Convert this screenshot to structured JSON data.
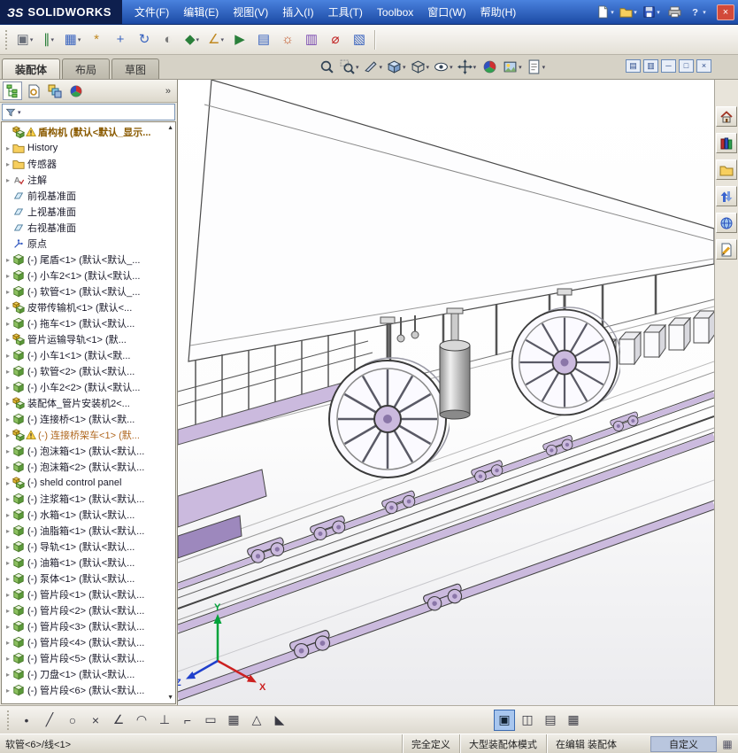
{
  "colors": {
    "accent-lavender": "#cbbade",
    "accent-lavender-dark": "#9d88bd",
    "outline": "#4a4a4a",
    "triad-x": "#cc2020",
    "triad-y": "#00a33a",
    "triad-z": "#2040cc",
    "titlebar-top": "#4a82de",
    "titlebar-bottom": "#1c4aa4",
    "selection-edit": "#b06820"
  },
  "titlebar": {
    "logo_mark": "ЗS",
    "logo_text": "SOLIDWORKS",
    "close_glyph": "×",
    "menus": [
      {
        "name": "menu-file",
        "label": "文件(F)"
      },
      {
        "name": "menu-edit",
        "label": "编辑(E)"
      },
      {
        "name": "menu-view",
        "label": "视图(V)"
      },
      {
        "name": "menu-insert",
        "label": "插入(I)"
      },
      {
        "name": "menu-tools",
        "label": "工具(T)"
      },
      {
        "name": "menu-toolbox",
        "label": "Toolbox"
      },
      {
        "name": "menu-window",
        "label": "窗口(W)"
      },
      {
        "name": "menu-help",
        "label": "帮助(H)"
      }
    ],
    "quick_icons": [
      {
        "name": "new-document-button",
        "sym": "page",
        "caret": true
      },
      {
        "name": "open-button",
        "sym": "folder",
        "caret": true
      },
      {
        "name": "save-button",
        "sym": "disk",
        "caret": true
      },
      {
        "name": "print-button",
        "sym": "printer"
      },
      {
        "name": "help-button",
        "sym": "help",
        "caret": true
      }
    ]
  },
  "toolbar": {
    "items": [
      {
        "name": "insert-components-button",
        "glyph": "▣",
        "color": "#6a6f7a",
        "caret": true
      },
      {
        "name": "mate-button",
        "glyph": "∥",
        "color": "#2a7f3a",
        "caret": true
      },
      {
        "name": "linear-component-pattern-button",
        "glyph": "▦",
        "color": "#3a64bf",
        "caret": true
      },
      {
        "name": "smart-fasteners-button",
        "glyph": "*",
        "color": "#c08820"
      },
      {
        "name": "move-component-button",
        "glyph": "+",
        "color": "#3a64bf"
      },
      {
        "name": "rotate-component-button",
        "glyph": "↻",
        "color": "#3a64bf"
      },
      {
        "name": "show-hidden-components-button",
        "glyph": "◐",
        "color": "#7a7a7a"
      },
      {
        "name": "assembly-features-button",
        "glyph": "◆",
        "color": "#2a7f3a",
        "caret": true
      },
      {
        "name": "reference-geometry-button",
        "glyph": "∠",
        "color": "#c08820",
        "caret": true
      },
      {
        "name": "new-motion-study-button",
        "glyph": "▶",
        "color": "#2a7f3a"
      },
      {
        "name": "bill-of-materials-button",
        "glyph": "▤",
        "color": "#3a64bf"
      },
      {
        "name": "exploded-view-button",
        "glyph": "☼",
        "color": "#c05020"
      },
      {
        "name": "interference-detection-button",
        "glyph": "▥",
        "color": "#7a4ab0"
      },
      {
        "name": "measure-button",
        "glyph": "⌀",
        "color": "#c02020"
      },
      {
        "name": "section-button",
        "glyph": "▧",
        "color": "#3a64bf"
      }
    ]
  },
  "tabs": [
    {
      "name": "tab-assembly",
      "label": "装配体",
      "active": true
    },
    {
      "name": "tab-layout",
      "label": "布局"
    },
    {
      "name": "tab-sketch",
      "label": "草图"
    }
  ],
  "headsup": {
    "items": [
      {
        "name": "zoom-fit-button",
        "sym": "zoom"
      },
      {
        "name": "zoom-area-button",
        "sym": "zoomwin",
        "caret": true
      },
      {
        "name": "section-view-button",
        "sym": "knife",
        "caret": true
      },
      {
        "name": "view-orientation-button",
        "sym": "cube3d",
        "caret": true
      },
      {
        "name": "display-style-button",
        "sym": "dstyle",
        "caret": true
      },
      {
        "name": "hide-show-items-button",
        "sym": "eye",
        "caret": true
      },
      {
        "name": "rotate-view-button",
        "sym": "move3d",
        "caret": true
      },
      {
        "name": "edit-appearance-button",
        "sym": "ball"
      },
      {
        "name": "apply-scene-button",
        "sym": "ball2",
        "caret": true
      },
      {
        "name": "view-settings-button",
        "sym": "note",
        "caret": true
      }
    ]
  },
  "doc_window_buttons": [
    {
      "name": "doc-cascade-button",
      "glyph": "▤"
    },
    {
      "name": "doc-tile-button",
      "glyph": "▥"
    },
    {
      "name": "doc-minimize-button",
      "glyph": "─"
    },
    {
      "name": "doc-restore-button",
      "glyph": "□"
    },
    {
      "name": "doc-close-button",
      "glyph": "×"
    }
  ],
  "manager_tabs": {
    "items": [
      {
        "name": "featuremanager-tab",
        "sym": "tree",
        "active": true
      },
      {
        "name": "propertymanager-tab",
        "sym": "prop"
      },
      {
        "name": "configurationmanager-tab",
        "sym": "config"
      },
      {
        "name": "displaymanager-tab",
        "sym": "ball"
      }
    ],
    "chevron": "»"
  },
  "tree": {
    "root": "盾构机 (默认<默认_显示...",
    "items": [
      {
        "sym": "folder",
        "label": "History",
        "arrow": true
      },
      {
        "sym": "folder",
        "label": "传感器",
        "arrow": true
      },
      {
        "sym": "annot",
        "label": "注解",
        "arrow": true
      },
      {
        "sym": "plane",
        "label": "前视基准面"
      },
      {
        "sym": "plane",
        "label": "上视基准面"
      },
      {
        "sym": "plane",
        "label": "右视基准面"
      },
      {
        "sym": "origin",
        "label": "原点"
      },
      {
        "sym": "part",
        "label": "(-) 尾盾<1> (默认<默认_...",
        "arrow": true
      },
      {
        "sym": "part",
        "label": "(-) 小车2<1> (默认<默认...",
        "arrow": true
      },
      {
        "sym": "part",
        "label": "(-) 软管<1> (默认<默认_...",
        "arrow": true
      },
      {
        "sym": "asm",
        "label": "皮带传输机<1> (默认<...",
        "arrow": true
      },
      {
        "sym": "part",
        "label": "(-) 拖车<1> (默认<默认...",
        "arrow": true
      },
      {
        "sym": "asm",
        "label": "管片运输导轨<1> (默...",
        "arrow": true
      },
      {
        "sym": "part",
        "label": "(-) 小车1<1> (默认<默...",
        "arrow": true
      },
      {
        "sym": "part",
        "label": "(-) 软管<2> (默认<默认...",
        "arrow": true
      },
      {
        "sym": "part",
        "label": "(-) 小车2<2> (默认<默认...",
        "arrow": true
      },
      {
        "sym": "asm",
        "label": "装配体_管片安装机2<...",
        "arrow": true
      },
      {
        "sym": "part",
        "label": "(-) 连接桥<1> (默认<默...",
        "arrow": true
      },
      {
        "sym": "asm",
        "label": "(-) 连接桥架车<1> (默...",
        "arrow": true,
        "warn": true,
        "selected": true
      },
      {
        "sym": "part",
        "label": "(-) 泡沫箱<1> (默认<默认...",
        "arrow": true
      },
      {
        "sym": "part",
        "label": "(-) 泡沫箱<2> (默认<默认...",
        "arrow": true
      },
      {
        "sym": "asm",
        "label": "(-) sheld control panel ",
        "arrow": true
      },
      {
        "sym": "part",
        "label": "(-) 注浆箱<1> (默认<默认...",
        "arrow": true
      },
      {
        "sym": "part",
        "label": "(-) 水箱<1> (默认<默认...",
        "arrow": true
      },
      {
        "sym": "part",
        "label": "(-) 油脂箱<1> (默认<默认...",
        "arrow": true
      },
      {
        "sym": "part",
        "label": "(-) 导轨<1> (默认<默认...",
        "arrow": true
      },
      {
        "sym": "part",
        "label": "(-) 油箱<1> (默认<默认...",
        "arrow": true
      },
      {
        "sym": "part",
        "label": "(-) 泵体<1> (默认<默认...",
        "arrow": true
      },
      {
        "sym": "part",
        "label": "(-) 管片段<1> (默认<默认...",
        "arrow": true
      },
      {
        "sym": "part",
        "label": "(-) 管片段<2> (默认<默认...",
        "arrow": true
      },
      {
        "sym": "part",
        "label": "(-) 管片段<3> (默认<默认...",
        "arrow": true
      },
      {
        "sym": "part",
        "label": "(-) 管片段<4> (默认<默认...",
        "arrow": true
      },
      {
        "sym": "part",
        "label": "(-) 管片段<5> (默认<默认...",
        "arrow": true
      },
      {
        "sym": "part",
        "label": "(-) 刀盘<1> (默认<默认...",
        "arrow": true
      },
      {
        "sym": "part",
        "label": "(-) 管片段<6> (默认<默认...",
        "arrow": true
      }
    ]
  },
  "task_pane": {
    "items": [
      {
        "name": "task-pane-home-button",
        "sym": "home"
      },
      {
        "name": "design-library-button",
        "sym": "books"
      },
      {
        "name": "file-explorer-button",
        "sym": "folder"
      },
      {
        "name": "search-results-button",
        "sym": "arrows"
      },
      {
        "name": "view-palette-button",
        "sym": "globe"
      },
      {
        "name": "custom-properties-button",
        "sym": "pencilpage"
      }
    ]
  },
  "sketch_toolbar": {
    "left": [
      {
        "name": "sketch-point-tool",
        "glyph": "•"
      },
      {
        "name": "sketch-line-tool",
        "glyph": "╱"
      },
      {
        "name": "sketch-circle-tool",
        "glyph": "○"
      },
      {
        "name": "sketch-spline-tool",
        "glyph": "×"
      },
      {
        "name": "sketch-angle-tool",
        "glyph": "∠"
      },
      {
        "name": "sketch-arc-tool",
        "glyph": "◠"
      },
      {
        "name": "sketch-perpendicular-tool",
        "glyph": "⊥"
      },
      {
        "name": "sketch-corner-tool",
        "glyph": "⌐"
      },
      {
        "name": "sketch-rectangle-tool",
        "glyph": "▭"
      },
      {
        "name": "sketch-pattern-tool",
        "glyph": "▦"
      },
      {
        "name": "sketch-mirror-tool",
        "glyph": "△"
      },
      {
        "name": "sketch-ruler-tool",
        "glyph": "◣"
      }
    ],
    "right": [
      {
        "name": "viewport-single-button",
        "glyph": "▣",
        "active": true
      },
      {
        "name": "viewport-split-horizontal-button",
        "glyph": "◫"
      },
      {
        "name": "viewport-split-vertical-button",
        "glyph": "▤"
      },
      {
        "name": "viewport-four-button",
        "glyph": "▦"
      }
    ]
  },
  "viewport": {
    "triad": {
      "x": "X",
      "y": "Y",
      "z": "Z"
    }
  },
  "statusbar": {
    "left": "软管<6>/线<1>",
    "defined": "完全定义",
    "mode": "大型装配体模式",
    "editing": "在编辑 装配体",
    "custom": "自定义",
    "grid_glyph": "▦"
  }
}
